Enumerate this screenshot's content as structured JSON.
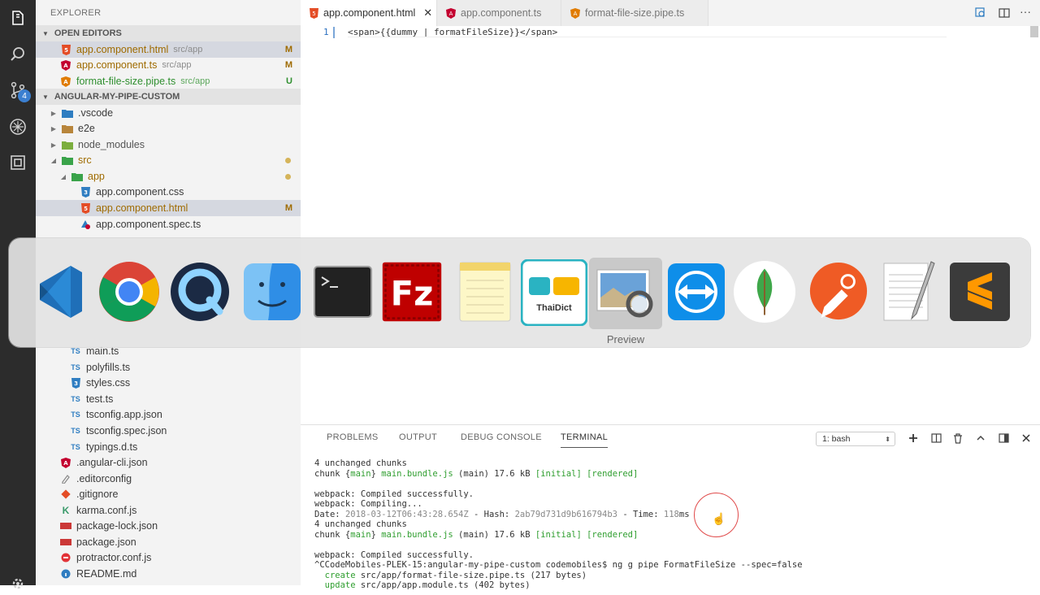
{
  "activity": {
    "badge": "4"
  },
  "sidebar": {
    "title": "EXPLORER",
    "open_editors_header": "OPEN EDITORS",
    "open_editors": [
      {
        "name": "app.component.html",
        "path": "src/app",
        "status": "M",
        "icon": "html-icon"
      },
      {
        "name": "app.component.ts",
        "path": "src/app",
        "status": "M",
        "icon": "angular-icon"
      },
      {
        "name": "format-file-size.pipe.ts",
        "path": "src/app",
        "status": "U",
        "icon": "angular-pipe-icon"
      }
    ],
    "project_header": "ANGULAR-MY-PIPE-CUSTOM",
    "tree_top": [
      {
        "name": ".vscode"
      },
      {
        "name": "e2e"
      },
      {
        "name": "node_modules"
      },
      {
        "name": "src"
      },
      {
        "name": "app"
      },
      {
        "name": "app.component.css"
      },
      {
        "name": "app.component.html",
        "status": "M"
      },
      {
        "name": "app.component.spec.ts"
      }
    ],
    "tree_bottom": [
      {
        "name": "main.ts",
        "icon": "TS"
      },
      {
        "name": "polyfills.ts",
        "icon": "TS"
      },
      {
        "name": "styles.css",
        "icon": "css"
      },
      {
        "name": "test.ts",
        "icon": "TS"
      },
      {
        "name": "tsconfig.app.json",
        "icon": "TS"
      },
      {
        "name": "tsconfig.spec.json",
        "icon": "TS"
      },
      {
        "name": "typings.d.ts",
        "icon": "TS"
      },
      {
        "name": ".angular-cli.json",
        "icon": "angular"
      },
      {
        "name": ".editorconfig",
        "icon": "editorconfig"
      },
      {
        "name": ".gitignore",
        "icon": "git"
      },
      {
        "name": "karma.conf.js",
        "icon": "karma"
      },
      {
        "name": "package-lock.json",
        "icon": "npm"
      },
      {
        "name": "package.json",
        "icon": "npm"
      },
      {
        "name": "protractor.conf.js",
        "icon": "protractor"
      },
      {
        "name": "README.md",
        "icon": "readme"
      }
    ]
  },
  "tabs": [
    {
      "label": "app.component.html",
      "close": "✕"
    },
    {
      "label": "app.component.ts"
    },
    {
      "label": "format-file-size.pipe.ts"
    }
  ],
  "editor": {
    "line_number": "1",
    "code": "<span>{{dummy | formatFileSize}}</span>"
  },
  "panel": {
    "tabs": [
      "PROBLEMS",
      "OUTPUT",
      "DEBUG CONSOLE",
      "TERMINAL"
    ],
    "terminal_select": "1: bash",
    "lines": {
      "l1": "4 unchanged chunks",
      "l2_a": "chunk {",
      "l2_b": "main",
      "l2_c": "} ",
      "l2_d": "main.bundle.js",
      "l2_e": " (main) 17.6 kB ",
      "l2_f": "[initial] [rendered]",
      "l3": "webpack: Compiled successfully.",
      "l4": "webpack: Compiling...",
      "l5_a": "Date: ",
      "l5_b": "2018-03-12T06:43:28.654Z",
      "l5_c": " - Hash: ",
      "l5_d": "2ab79d731d9b616794b3",
      "l5_e": " - Time: ",
      "l5_f": "118",
      "l5_g": "ms",
      "l6": "4 unchanged chunks",
      "l7_a": "chunk {",
      "l7_b": "main",
      "l7_c": "} ",
      "l7_d": "main.bundle.js",
      "l7_e": " (main) 17.6 kB ",
      "l7_f": "[initial] [rendered]",
      "l8": "webpack: Compiled successfully.",
      "l9": "^CCodeMobiles-PLEK-15:angular-my-pipe-custom codemobiles$ ng g pipe FormatFileSize --spec=false",
      "l10_a": "  create",
      "l10_b": " src/app/format-file-size.pipe.ts (217 bytes)",
      "l11_a": "  update",
      "l11_b": " src/app/app.module.ts (402 bytes)"
    }
  },
  "dock": {
    "apps": [
      "Visual Studio Code",
      "Google Chrome",
      "QuickTime Player",
      "Finder",
      "Terminal",
      "FileZilla",
      "Notes",
      "ThaiDict",
      "Preview",
      "TeamViewer",
      "MongoDB Compass",
      "Postman",
      "TextEdit",
      "Sublime Text"
    ],
    "thaidict_label": "ThaiDict",
    "hover_label": "Preview"
  },
  "colors": {
    "accent": "#2a6fc0",
    "modified": "#9f6b00",
    "untracked": "#2f8f2f",
    "activity_bar": "#2c2c2c"
  }
}
